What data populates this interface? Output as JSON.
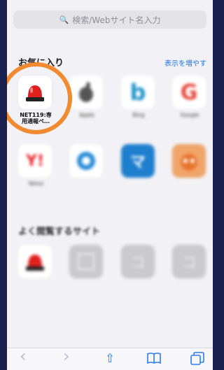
{
  "search": {
    "placeholder": "検索/Webサイト名入力"
  },
  "favorites": {
    "title": "お気に入り",
    "more_label": "表示を増やす",
    "items": [
      {
        "label": "NET119:専\n用通報ペ…",
        "icon": "siren-icon"
      },
      {
        "label": "Apple",
        "icon": "apple-icon"
      },
      {
        "label": "Bing",
        "icon": "bing-icon"
      },
      {
        "label": "Google",
        "icon": "google-icon"
      },
      {
        "label": "Yahoo",
        "icon": "yahoo-icon"
      },
      {
        "label": "",
        "icon": "compass-icon"
      },
      {
        "label": "",
        "icon": "bookmark-icon"
      },
      {
        "label": "",
        "icon": "character-icon"
      }
    ]
  },
  "frequent": {
    "title": "よく閲覧するサイト",
    "items": [
      {
        "label": "",
        "icon": "siren-icon"
      },
      {
        "label": "",
        "icon": "page-icon"
      },
      {
        "label": "",
        "icon": "letter-icon"
      },
      {
        "label": "",
        "icon": "letter-icon"
      }
    ]
  },
  "toolbar": {
    "back": "‹",
    "forward": "›",
    "share": "⇧",
    "bookmarks": "📖",
    "tabs": "⧉"
  },
  "colors": {
    "accent": "#2a7df0",
    "ring": "#f28a32",
    "siren_red": "#e0201f"
  }
}
